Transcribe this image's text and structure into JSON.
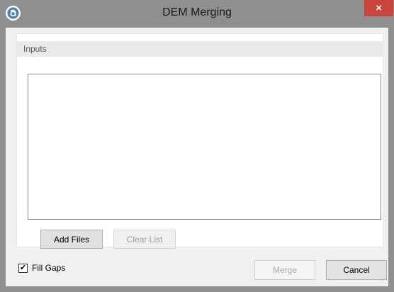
{
  "window": {
    "title": "DEM Merging",
    "close_glyph": "×",
    "app_icon": "app-logo-icon",
    "colors": {
      "titlebar": "#8f8f8f",
      "close": "#c9443c",
      "client": "#f0f0f0"
    }
  },
  "inputs_group": {
    "header": "Inputs",
    "files": []
  },
  "buttons": {
    "add_files": "Add Files",
    "clear_list": "Clear List",
    "merge": "Merge",
    "cancel": "Cancel"
  },
  "options": {
    "fill_gaps_label": "Fill Gaps",
    "fill_gaps_checked": true,
    "check_glyph": "✔"
  }
}
